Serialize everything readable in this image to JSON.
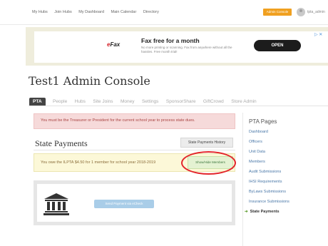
{
  "topnav": {
    "links": [
      "My Hubs",
      "Join Hubs",
      "My Dashboard",
      "Main Calendar",
      "Directory"
    ],
    "admin_button": "Admin Console",
    "user_name": "tpta_admin"
  },
  "ad": {
    "brand_e": "e",
    "brand_rest": "Fax",
    "title": "Fax free for a month",
    "text": "No more printing or scanning. Fax from anywhere without all the hassles. Free month trial!",
    "open_label": "OPEN",
    "close_label": "▷ ✕"
  },
  "console_title": "Test1 Admin Console",
  "tabs": [
    "PTA",
    "People",
    "Hubs",
    "Site Joins",
    "Money",
    "Settings",
    "SponsorShare",
    "GiftCrowd",
    "Store Admin"
  ],
  "error_message": "You must be the Treasurer or President for the current school year to process state dues.",
  "section": {
    "title": "State Payments",
    "history_button": "State Payments History"
  },
  "owe": {
    "message": "You owe the ILPTA $4.50 for 1 member for school year 2018-2019",
    "showhide_button": "Show/Hide Members"
  },
  "echeck_button": "Send Payment via eCheck",
  "sidebar": {
    "title": "PTA Pages",
    "items": [
      {
        "label": "Dashboard"
      },
      {
        "label": "Officers"
      },
      {
        "label": "Unit Data"
      },
      {
        "label": "Members"
      },
      {
        "label": "Audit Submissions"
      },
      {
        "label": "IHSI Requirements"
      },
      {
        "label": "ByLaws Submissions"
      },
      {
        "label": "Insurance Submissions"
      },
      {
        "label": "State Payments"
      }
    ]
  },
  "colors": {
    "accent_orange": "#f0a020",
    "error_bg": "#f6dada",
    "warning_bg": "#fcf8d8",
    "highlight_ellipse": "#e3242b"
  }
}
